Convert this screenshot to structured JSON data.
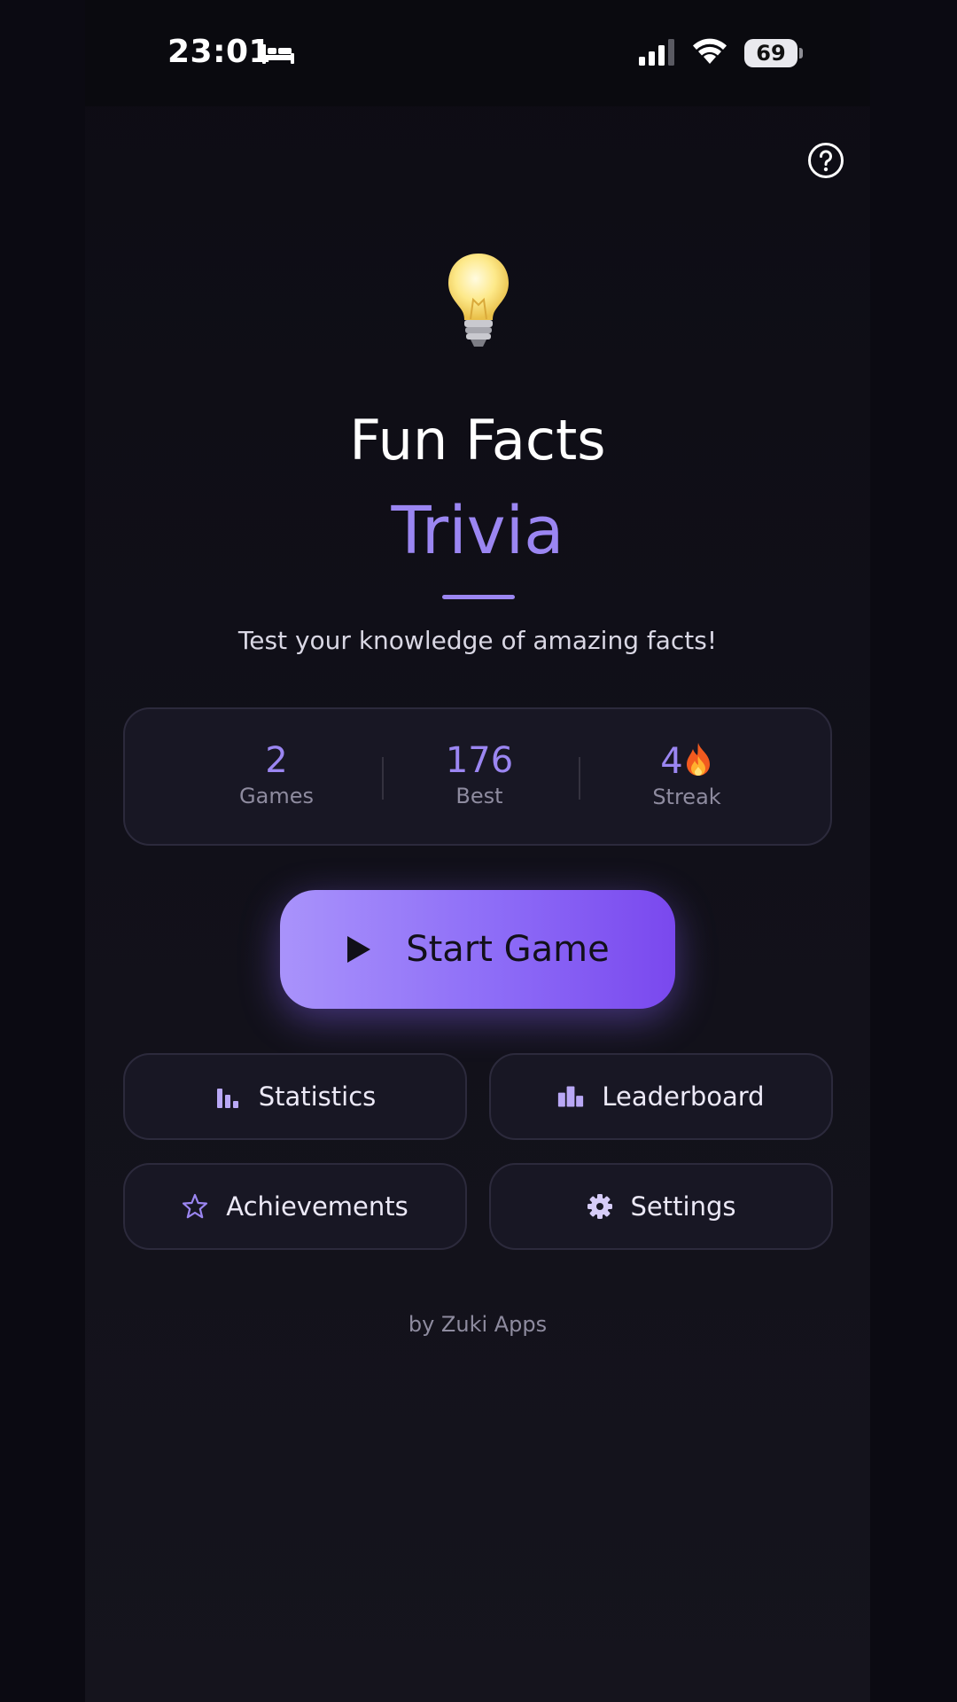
{
  "status_bar": {
    "time": "23:01",
    "battery_level": "69"
  },
  "app": {
    "title_line1": "Fun Facts",
    "title_line2": "Trivia",
    "subtitle": "Test your knowledge of amazing facts!",
    "accent_color": "#9b86f2"
  },
  "stats": {
    "games": {
      "value": "2",
      "label": "Games"
    },
    "best": {
      "value": "176",
      "label": "Best"
    },
    "streak": {
      "value": "4",
      "label": "Streak",
      "icon": "flame-icon"
    }
  },
  "start_button": {
    "label": "Start Game",
    "icon": "play-icon"
  },
  "actions": {
    "statistics": {
      "label": "Statistics",
      "icon": "bar-chart-icon"
    },
    "leaderboard": {
      "label": "Leaderboard",
      "icon": "leaderboard-icon"
    },
    "achievements": {
      "label": "Achievements",
      "icon": "star-icon"
    },
    "settings": {
      "label": "Settings",
      "icon": "gear-icon"
    }
  },
  "footer": {
    "credit": "by Zuki Apps"
  }
}
